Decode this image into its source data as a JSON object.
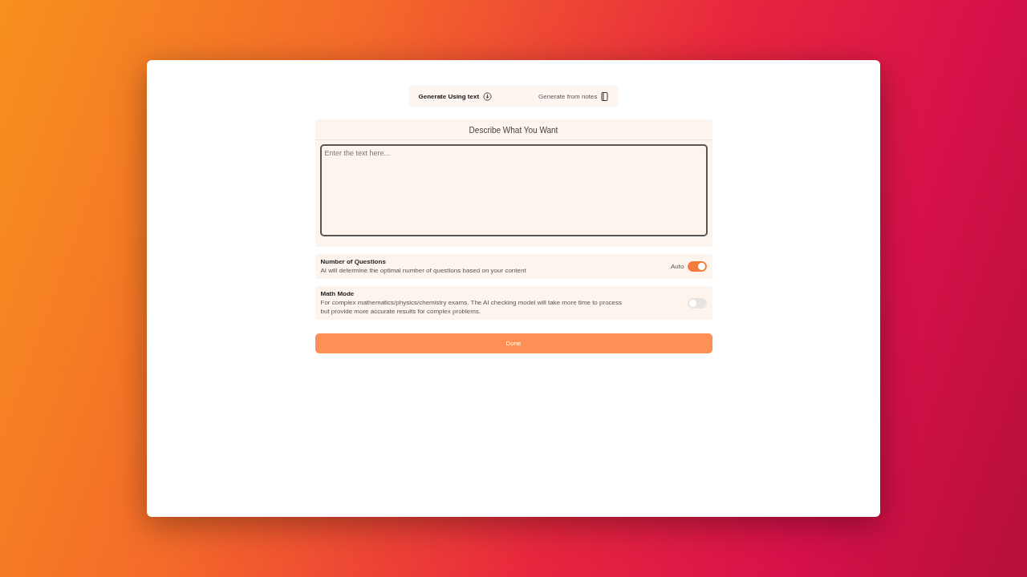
{
  "tabs": [
    {
      "label": "Generate Using text",
      "selected": true
    },
    {
      "label": "Generate from notes",
      "selected": false
    }
  ],
  "prompt": {
    "title": "Describe What You Want",
    "placeholder": "Enter the text here..."
  },
  "settings": [
    {
      "title": "Number of Questions",
      "description": "AI will determine the optimal number of questions based on your content",
      "badge": "Auto",
      "on": true
    },
    {
      "title": "Math Mode",
      "description": "For complex mathematics/physics/chemistry exams. The AI checking model will take more time to process but provide more accurate results for complex problems.",
      "on": false
    }
  ],
  "done_button": "Done"
}
